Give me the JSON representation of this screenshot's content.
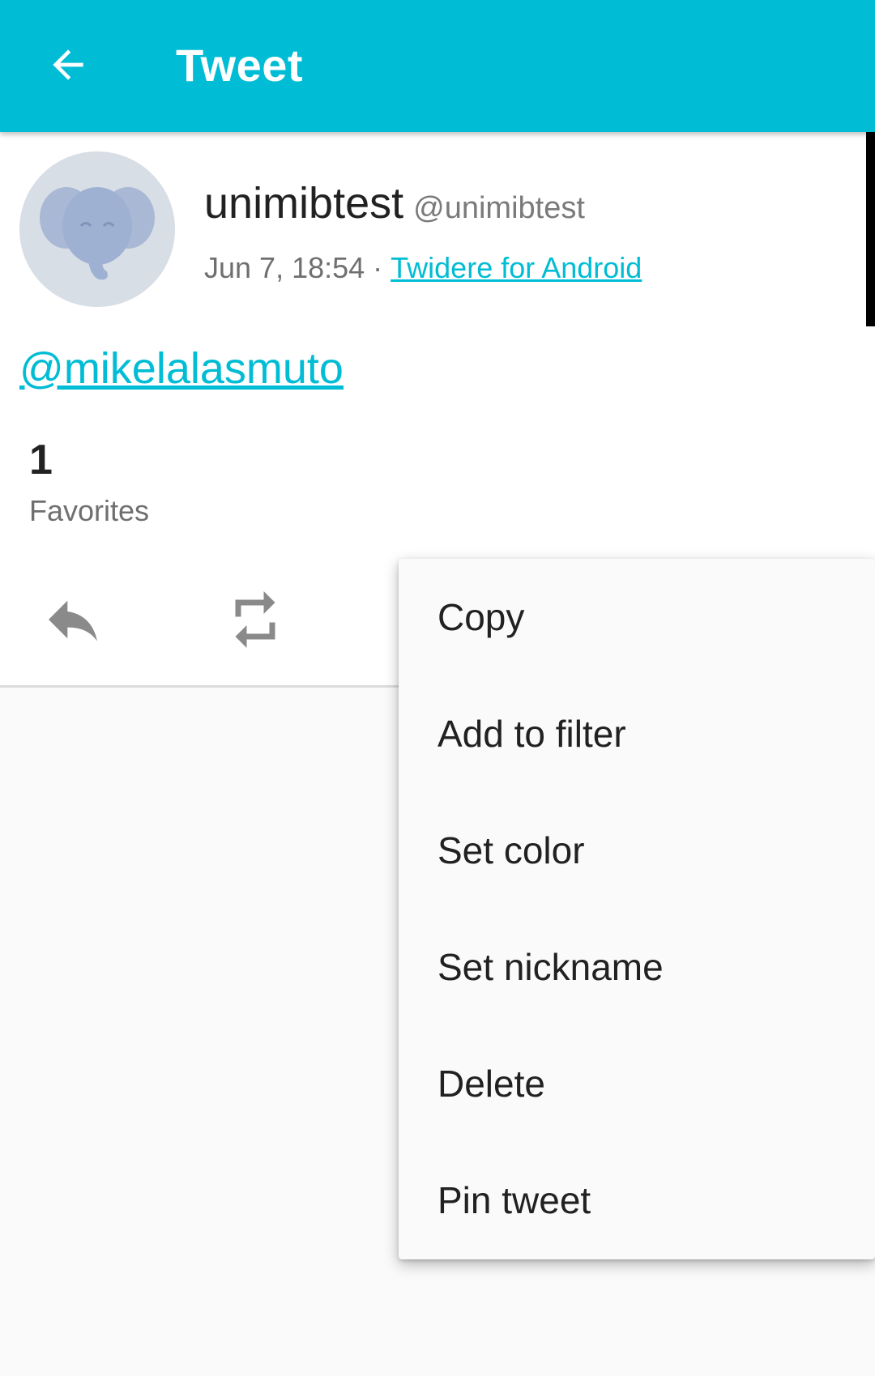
{
  "appbar": {
    "title": "Tweet",
    "back_icon": "arrow-back-icon",
    "background": "#00bcd4"
  },
  "status": {
    "display_name": "unimibtest",
    "screen_name": "@unimibtest",
    "time": "Jun 7, 18:54 · ",
    "source": "Twidere for Android",
    "text_mention": "@mikelalasmuto",
    "favorites_count": "1",
    "favorites_label": "Favorites"
  },
  "actions": [
    {
      "name": "reply",
      "icon": "reply-icon"
    },
    {
      "name": "retweet",
      "icon": "retweet-icon"
    }
  ],
  "menu": {
    "items": [
      "Copy",
      "Add to filter",
      "Set color",
      "Set nickname",
      "Delete",
      "Pin tweet"
    ]
  },
  "colors": {
    "accent": "#00bcd4",
    "text_primary": "#212121",
    "text_secondary": "#6f6f6f"
  }
}
